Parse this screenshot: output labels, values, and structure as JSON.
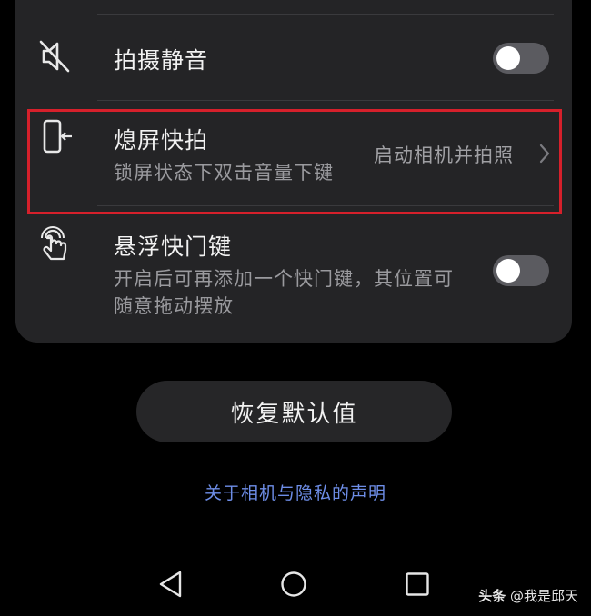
{
  "settings": {
    "items": [
      {
        "icon": "mute-icon",
        "title": "拍摄静音",
        "toggle_on": false
      },
      {
        "icon": "screen-off-snapshot-icon",
        "title": "熄屏快拍",
        "subtitle": "锁屏状态下双击音量下键",
        "value": "启动相机并拍照"
      },
      {
        "icon": "touch-gesture-icon",
        "title": "悬浮快门键",
        "subtitle": "开启后可再添加一个快门键，其位置可随意拖动摆放",
        "toggle_on": false
      }
    ]
  },
  "actions": {
    "reset_label": "恢复默认值",
    "privacy_link": "关于相机与隐私的声明"
  },
  "watermark": {
    "brand": "头条",
    "author": "@我是邱天"
  },
  "colors": {
    "background": "#000000",
    "card": "#242426",
    "highlight": "#d6202b",
    "link": "#6e8ee8",
    "toggle_off": "#5b5b60"
  }
}
